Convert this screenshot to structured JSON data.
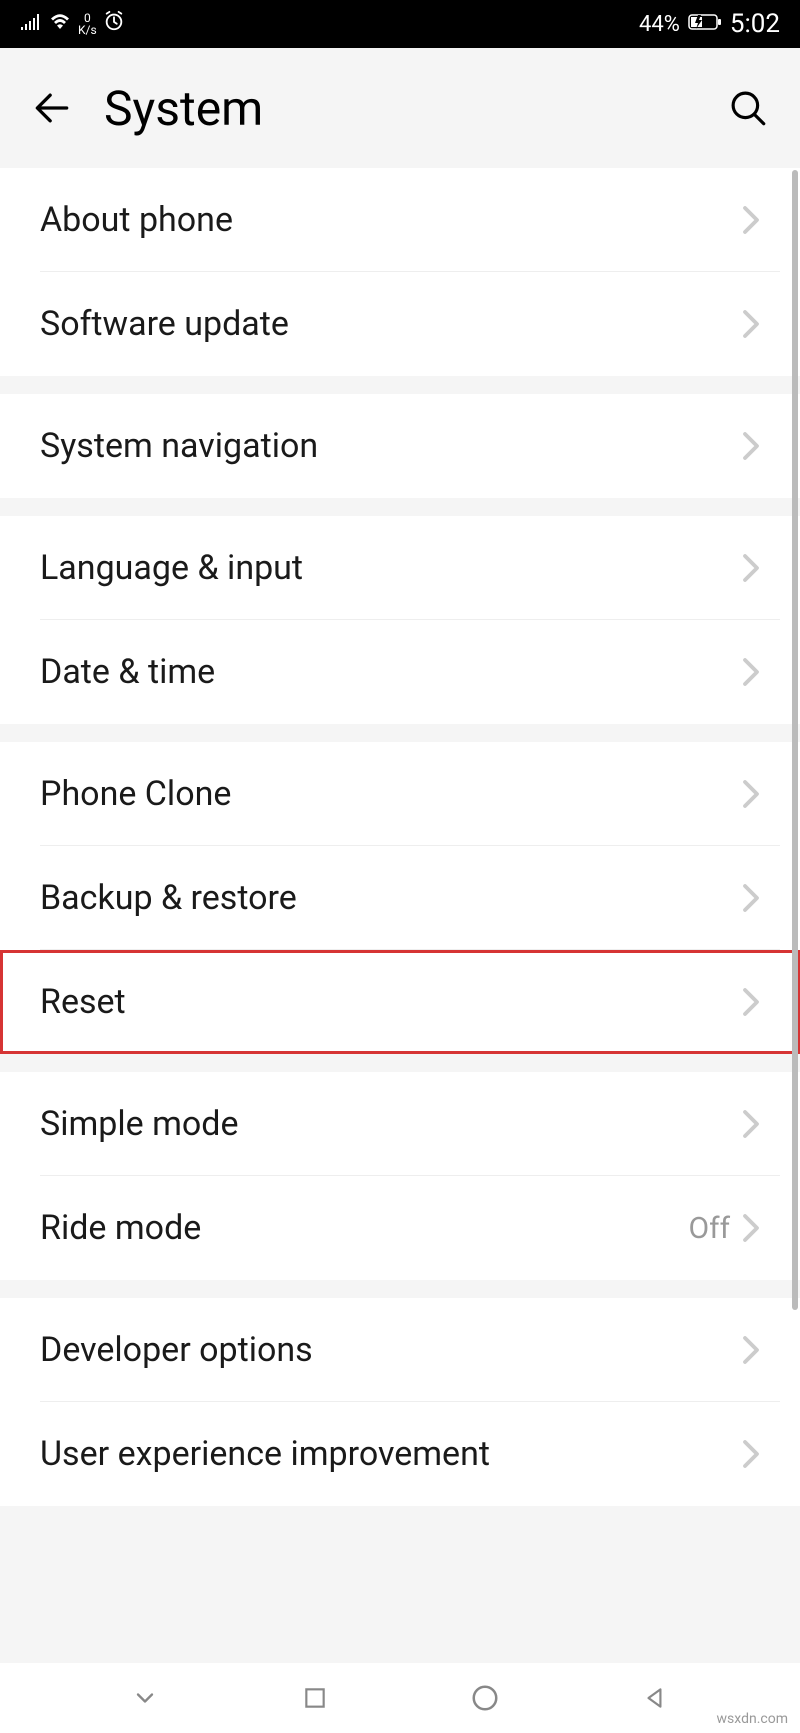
{
  "statusbar": {
    "speed_value": "0",
    "speed_unit": "K/s",
    "battery_percent": "44%",
    "time": "5:02"
  },
  "header": {
    "title": "System"
  },
  "groups": [
    {
      "items": [
        {
          "label": "About phone"
        },
        {
          "label": "Software update"
        }
      ]
    },
    {
      "items": [
        {
          "label": "System navigation"
        }
      ]
    },
    {
      "items": [
        {
          "label": "Language & input"
        },
        {
          "label": "Date & time"
        }
      ]
    },
    {
      "items": [
        {
          "label": "Phone Clone"
        },
        {
          "label": "Backup & restore"
        },
        {
          "label": "Reset",
          "highlighted": true
        }
      ]
    },
    {
      "items": [
        {
          "label": "Simple mode"
        },
        {
          "label": "Ride mode",
          "value": "Off"
        }
      ]
    },
    {
      "items": [
        {
          "label": "Developer options"
        },
        {
          "label": "User experience improvement"
        }
      ]
    }
  ],
  "watermark": "wsxdn.com"
}
